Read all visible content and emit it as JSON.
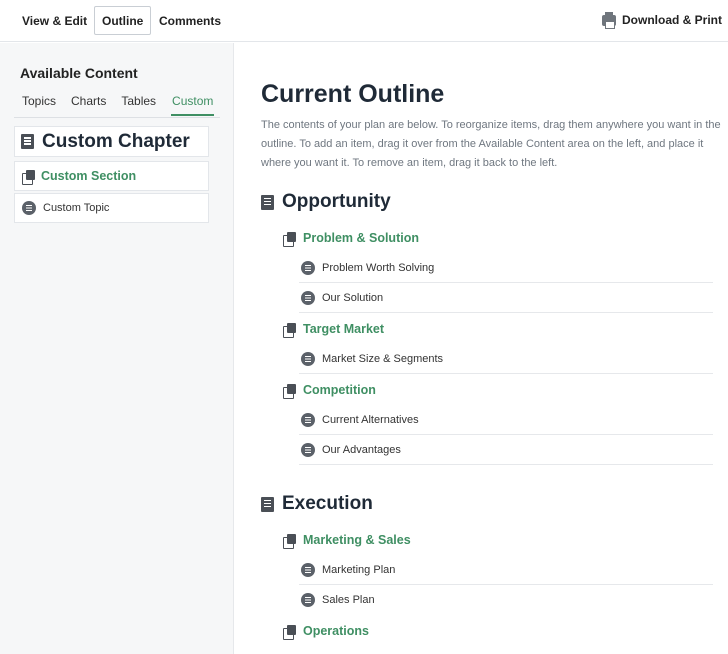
{
  "toolbar": {
    "tabs": [
      {
        "label": "View & Edit",
        "active": false
      },
      {
        "label": "Outline",
        "active": true
      },
      {
        "label": "Comments",
        "active": false
      }
    ],
    "print_label": "Download & Print"
  },
  "sidebar": {
    "title": "Available Content",
    "tabs": [
      {
        "label": "Topics",
        "active": false
      },
      {
        "label": "Charts",
        "active": false
      },
      {
        "label": "Tables",
        "active": false
      },
      {
        "label": "Custom",
        "active": true
      }
    ],
    "items": [
      {
        "type": "chapter",
        "label": "Custom Chapter",
        "icon": "book-icon"
      },
      {
        "type": "section",
        "label": "Custom Section",
        "icon": "pages-icon"
      },
      {
        "type": "topic",
        "label": "Custom Topic",
        "icon": "topic-icon"
      }
    ]
  },
  "main": {
    "title": "Current Outline",
    "intro": "The contents of your plan are below. To reorganize items, drag them anywhere you want in the outline. To add an item, drag it over from the Available Content area on the left, and place it where you want it. To remove an item, drag it back to the left.",
    "chapters": [
      {
        "label": "Opportunity",
        "sections": [
          {
            "label": "Problem & Solution",
            "topics": [
              "Problem Worth Solving",
              "Our Solution"
            ]
          },
          {
            "label": "Target Market",
            "topics": [
              "Market Size & Segments"
            ]
          },
          {
            "label": "Competition",
            "topics": [
              "Current Alternatives",
              "Our Advantages"
            ]
          }
        ]
      },
      {
        "label": "Execution",
        "sections": [
          {
            "label": "Marketing & Sales",
            "topics": [
              "Marketing Plan",
              "Sales Plan"
            ]
          },
          {
            "label": "Operations",
            "topics": []
          }
        ]
      }
    ]
  },
  "colors": {
    "accent_green": "#3f8f63",
    "heading": "#1f2a37",
    "muted_text": "#6f7780",
    "sidebar_bg": "#f6f7f8"
  }
}
